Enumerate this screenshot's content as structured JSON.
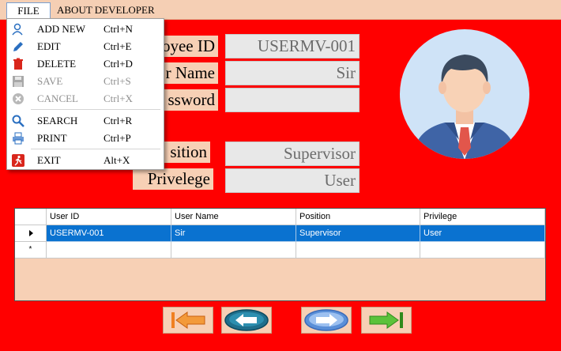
{
  "menubar": {
    "file": "FILE",
    "about": "ABOUT DEVELOPER"
  },
  "file_menu": [
    {
      "label": "ADD NEW",
      "shortcut": "Ctrl+N",
      "icon": "add-user-icon",
      "enabled": true
    },
    {
      "label": "EDIT",
      "shortcut": "Ctrl+E",
      "icon": "pencil-icon",
      "enabled": true
    },
    {
      "label": "DELETE",
      "shortcut": "Ctrl+D",
      "icon": "trash-icon",
      "enabled": true
    },
    {
      "label": "SAVE",
      "shortcut": "Ctrl+S",
      "icon": "floppy-icon",
      "enabled": false
    },
    {
      "label": "CANCEL",
      "shortcut": "Ctrl+X",
      "icon": "cancel-icon",
      "enabled": false
    },
    {
      "label": "SEARCH",
      "shortcut": "Ctrl+R",
      "icon": "search-icon",
      "enabled": true
    },
    {
      "label": "PRINT",
      "shortcut": "Ctrl+P",
      "icon": "print-icon",
      "enabled": true
    },
    {
      "label": "EXIT",
      "shortcut": "Alt+X",
      "icon": "exit-icon",
      "enabled": true
    }
  ],
  "form": {
    "employee_id_label": "oyee ID",
    "employee_id_value": "USERMV-001",
    "user_name_label": "r Name",
    "user_name_value": "Sir",
    "password_label": "ssword",
    "password_value": "",
    "position_label": "sition",
    "position_value": "Supervisor",
    "privilege_label": "Privelege",
    "privilege_value": "User"
  },
  "grid": {
    "columns": [
      "User ID",
      "User Name",
      "Position",
      "Privilege"
    ],
    "rows": [
      [
        "USERMV-001",
        "Sir",
        "Supervisor",
        "User"
      ]
    ],
    "new_row_marker": "*"
  },
  "nav": {
    "first_icon": "first-record-icon",
    "prev_icon": "previous-record-icon",
    "next_icon": "next-record-icon",
    "last_icon": "last-record-icon"
  },
  "colors": {
    "background": "#ff0000",
    "panel": "#f7d0b5",
    "selection": "#0a72d0"
  }
}
